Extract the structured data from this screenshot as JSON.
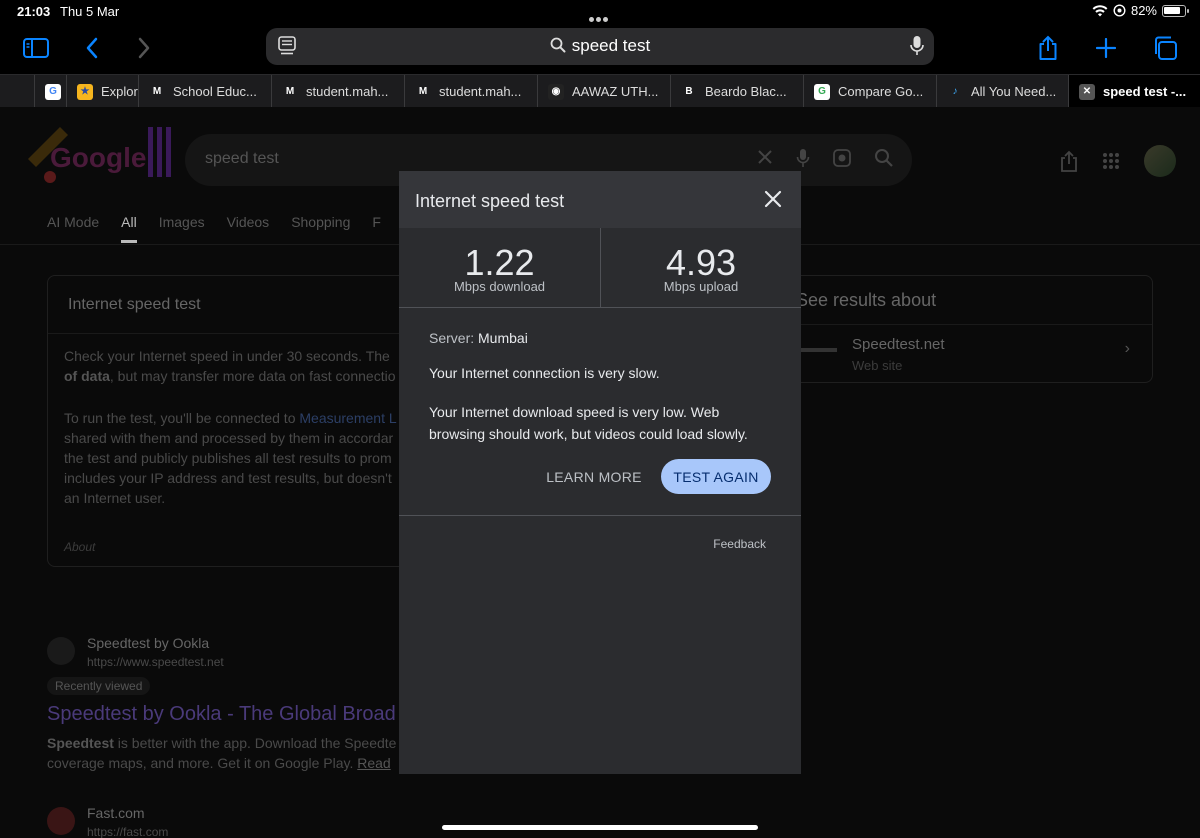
{
  "status": {
    "time": "21:03",
    "date": "Thu 5 Mar",
    "battery": "82%"
  },
  "toolbar": {
    "url_text": "speed test"
  },
  "tabs": [
    {
      "label": "",
      "favicon": "G",
      "fav_bg": "#ffffff",
      "fav_fg": "#4285f4"
    },
    {
      "label": "Explore",
      "favicon": "★",
      "fav_bg": "#f6b51e",
      "fav_fg": "#2a4aa0"
    },
    {
      "label": "School Educ...",
      "favicon": "M",
      "fav_bg": "#1c1c1e",
      "fav_fg": "#ffffff"
    },
    {
      "label": "student.mah...",
      "favicon": "M",
      "fav_bg": "#1c1c1e",
      "fav_fg": "#ffffff"
    },
    {
      "label": "student.mah...",
      "favicon": "M",
      "fav_bg": "#1c1c1e",
      "fav_fg": "#ffffff"
    },
    {
      "label": "AAWAZ UTH...",
      "favicon": "◉",
      "fav_bg": "#222",
      "fav_fg": "#ffffff"
    },
    {
      "label": "Beardo Blac...",
      "favicon": "B",
      "fav_bg": "#1c1c1e",
      "fav_fg": "#ffffff"
    },
    {
      "label": "Compare Go...",
      "favicon": "G",
      "fav_bg": "#ffffff",
      "fav_fg": "#34a853"
    },
    {
      "label": "All You Need...",
      "favicon": "♪",
      "fav_bg": "#1c1c1e",
      "fav_fg": "#3fa9f5"
    },
    {
      "label": "speed test -...",
      "favicon": "✕",
      "fav_bg": "#555",
      "fav_fg": "#ffffff"
    }
  ],
  "google": {
    "search_query": "speed test",
    "nav_tabs": [
      "AI Mode",
      "All",
      "Images",
      "Videos",
      "Shopping",
      "F"
    ],
    "card_title": "Internet speed test",
    "card_text_1a": "Check your Internet speed in under 30 seconds. The",
    "card_text_1b": "of data",
    "card_text_1c": ", but may transfer more data on fast connectio",
    "card_text_2a": "To run the test, you'll be connected to ",
    "card_text_2_link": "Measurement L",
    "card_text_2b": "shared with them and processed by them in accordar",
    "card_text_2c": "the test and publicly publishes all test results to prom",
    "card_text_2d": "includes your IP address and test results, but doesn't",
    "card_text_2e": "an Internet user.",
    "card_about": "About",
    "side_title": "See results about",
    "side_name": "Speedtest.net",
    "side_sub": "Web site",
    "result1_name": "Speedtest by Ookla",
    "result1_url": "https://www.speedtest.net",
    "result1_badge": "Recently viewed",
    "result1_title": "Speedtest by Ookla - The Global Broad",
    "result1_desc_bold": "Speedtest",
    "result1_desc_a": " is better with the app. Download the Speedte",
    "result1_desc_b": "coverage maps, and more. Get it on Google Play. ",
    "result1_desc_link": "Read",
    "result2_name": "Fast.com",
    "result2_url": "https://fast.com"
  },
  "modal": {
    "title": "Internet speed test",
    "download_value": "1.22",
    "download_unit": "Mbps download",
    "upload_value": "4.93",
    "upload_unit": "Mbps upload",
    "server_label": "Server: ",
    "server_value": "Mumbai",
    "message_1": "Your Internet connection is very slow.",
    "message_2": "Your Internet download speed is very low. Web browsing should work, but videos could load slowly.",
    "learn_more": "LEARN MORE",
    "test_again": "TEST AGAIN",
    "feedback": "Feedback"
  },
  "colors": {
    "accent": "#0a84ff",
    "test_button": "#a8c7fa",
    "modal_bg": "#2b2c2f"
  }
}
